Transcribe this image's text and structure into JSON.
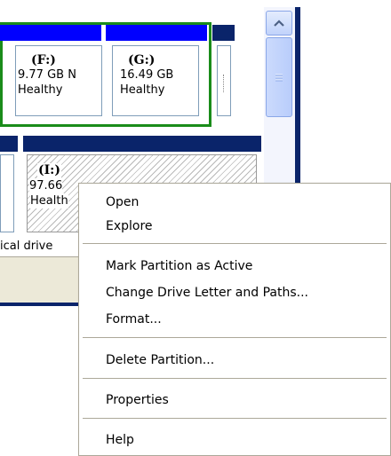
{
  "partitions": {
    "F": {
      "title": "(F:)",
      "size": "9.77 GB N",
      "status": "Healthy"
    },
    "G": {
      "title": "(G:)",
      "size": "16.49 GB",
      "status": "Healthy"
    },
    "I": {
      "title": "(I:)",
      "size": "97.66",
      "status": "Health"
    }
  },
  "legend": {
    "logical_drive": "ical drive"
  },
  "context_menu": {
    "items": [
      {
        "label": "Open"
      },
      {
        "label": "Explore"
      },
      {
        "label": "Mark Partition as Active"
      },
      {
        "label": "Change Drive Letter and Paths..."
      },
      {
        "label": "Format..."
      },
      {
        "label": "Delete Partition..."
      },
      {
        "label": "Properties"
      },
      {
        "label": "Help"
      }
    ]
  },
  "colors": {
    "extended_outline": "#1a8c1a",
    "primary_bar": "#0000ff",
    "selected_bar": "#0a246a"
  },
  "icons": {
    "scroll_up": "up-chevron-icon",
    "scroll_thumb": "grip-icon"
  }
}
